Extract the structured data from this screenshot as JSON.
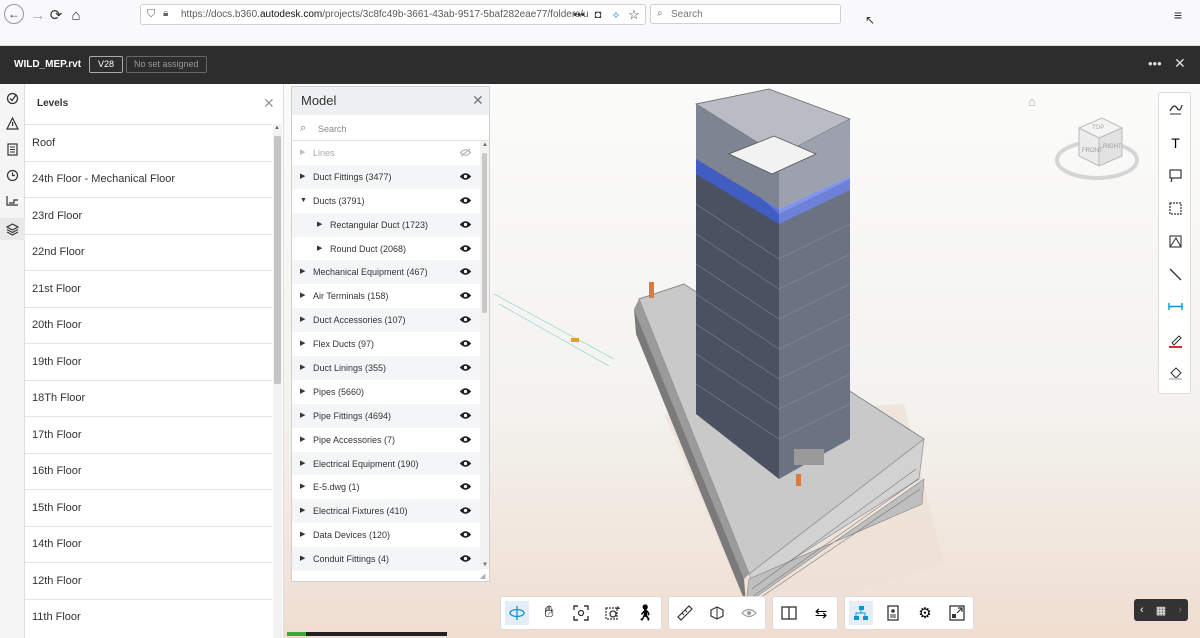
{
  "browser": {
    "url_prefix": "https://docs.b360.",
    "url_domain": "autodesk.com",
    "url_suffix": "/projects/3c8fc49b-3661-43ab-9517-5baf282eae77/folders/u",
    "search_placeholder": "Search"
  },
  "header": {
    "file_name": "WILD_MEP.rvt",
    "version": "V28",
    "set_status": "No set assigned"
  },
  "levels": {
    "title": "Levels",
    "items": [
      "Roof",
      "24th Floor - Mechanical Floor",
      "23rd Floor",
      "22nd Floor",
      "21st Floor",
      "20th Floor",
      "19th Floor",
      "18Th Floor",
      "17th Floor",
      "16th Floor",
      "15th Floor",
      "14th Floor",
      "12th Floor",
      "11th Floor"
    ]
  },
  "model": {
    "title": "Model",
    "search_placeholder": "Search",
    "tree": [
      {
        "label": "Lines",
        "depth": 0,
        "dim": true
      },
      {
        "label": "Duct Fittings (3477)",
        "depth": 0
      },
      {
        "label": "Ducts (3791)",
        "depth": 0,
        "expanded": true
      },
      {
        "label": "Rectangular Duct (1723)",
        "depth": 1
      },
      {
        "label": "Round Duct (2068)",
        "depth": 1
      },
      {
        "label": "Mechanical Equipment (467)",
        "depth": 0
      },
      {
        "label": "Air Terminals (158)",
        "depth": 0
      },
      {
        "label": "Duct Accessories (107)",
        "depth": 0
      },
      {
        "label": "Flex Ducts (97)",
        "depth": 0
      },
      {
        "label": "Duct Linings (355)",
        "depth": 0
      },
      {
        "label": "Pipes (5660)",
        "depth": 0
      },
      {
        "label": "Pipe Fittings (4694)",
        "depth": 0
      },
      {
        "label": "Pipe Accessories (7)",
        "depth": 0
      },
      {
        "label": "Electrical Equipment (190)",
        "depth": 0
      },
      {
        "label": "E-5.dwg (1)",
        "depth": 0
      },
      {
        "label": "Electrical Fixtures (410)",
        "depth": 0
      },
      {
        "label": "Data Devices (120)",
        "depth": 0
      },
      {
        "label": "Conduit Fittings (4)",
        "depth": 0
      }
    ]
  },
  "viewcube": {
    "top": "TOP",
    "front": "FRONT",
    "right": "RIGHT"
  },
  "loading_progress": 0.12,
  "colors": {
    "accent": "#0696d7",
    "header_bg": "#2d2d2d",
    "progress": "#3aa935"
  }
}
